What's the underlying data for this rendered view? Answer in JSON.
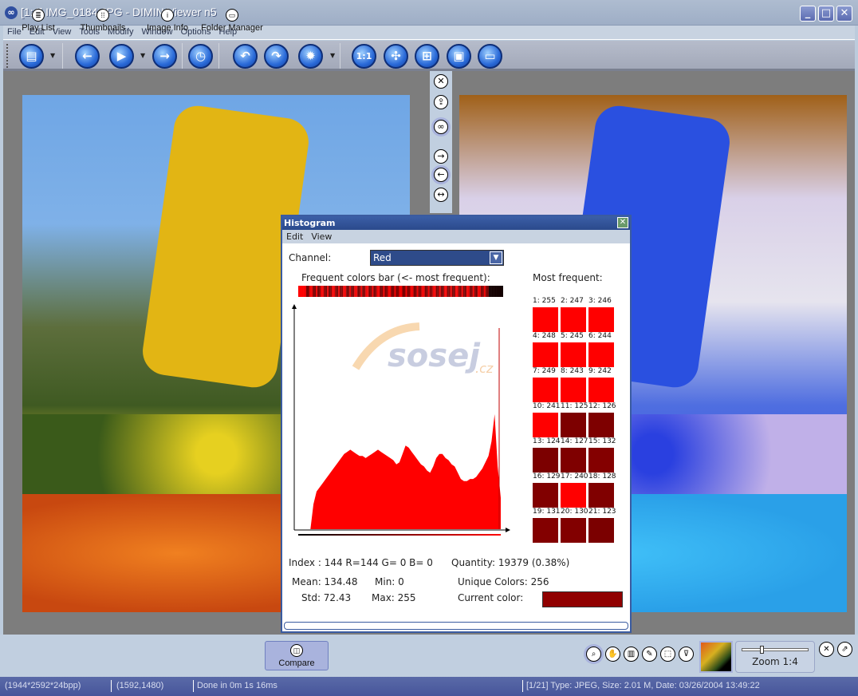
{
  "window": {
    "title": "[1:4] IMG_0184.JPG - DIMIN Viewer n5",
    "app_icon": "dimin-logo-icon",
    "controls": [
      "minimize",
      "maximize",
      "close"
    ]
  },
  "menu": [
    "File",
    "Edit",
    "View",
    "Tools",
    "Modify",
    "Window",
    "Options",
    "Help"
  ],
  "toolbar": {
    "buttons": [
      {
        "name": "open-folder",
        "glyph": "▤",
        "dropdown": true
      },
      {
        "name": "previous",
        "glyph": "←"
      },
      {
        "name": "play",
        "glyph": "▶",
        "dropdown": true
      },
      {
        "name": "next",
        "glyph": "→"
      },
      {
        "name": "slideshow-timer",
        "glyph": "◷"
      },
      {
        "name": "rotate-left",
        "glyph": "↶"
      },
      {
        "name": "rotate-right",
        "glyph": "↷"
      },
      {
        "name": "settings",
        "glyph": "✹",
        "dropdown": true
      },
      {
        "name": "actual-size",
        "glyph": "1:1"
      },
      {
        "name": "fit-to-window",
        "glyph": "✣"
      },
      {
        "name": "fit-to-screen",
        "glyph": "⊞"
      },
      {
        "name": "fullscreen",
        "glyph": "▣"
      },
      {
        "name": "monitor",
        "glyph": "▭"
      }
    ]
  },
  "compare_sidebar": [
    {
      "name": "close-compare",
      "glyph": "✕"
    },
    {
      "name": "export",
      "glyph": "⇪"
    },
    {
      "name": "link-views",
      "glyph": "∞",
      "active": true
    },
    {
      "name": "next-compare",
      "glyph": "→"
    },
    {
      "name": "prev-compare",
      "glyph": "←",
      "active": true
    },
    {
      "name": "swap",
      "glyph": "↔"
    }
  ],
  "histogram": {
    "title": "Histogram",
    "menu": [
      "Edit",
      "View"
    ],
    "channel_label": "Channel:",
    "channel_value": "Red",
    "freq_bar_label": "Frequent colors bar (<- most frequent):",
    "most_frequent_label": "Most frequent:",
    "most_frequent": [
      {
        "rank": 1,
        "value": 255
      },
      {
        "rank": 2,
        "value": 247
      },
      {
        "rank": 3,
        "value": 246
      },
      {
        "rank": 4,
        "value": 248
      },
      {
        "rank": 5,
        "value": 245
      },
      {
        "rank": 6,
        "value": 244
      },
      {
        "rank": 7,
        "value": 249
      },
      {
        "rank": 8,
        "value": 243
      },
      {
        "rank": 9,
        "value": 242
      },
      {
        "rank": 10,
        "value": 241
      },
      {
        "rank": 11,
        "value": 125
      },
      {
        "rank": 12,
        "value": 126
      },
      {
        "rank": 13,
        "value": 124
      },
      {
        "rank": 14,
        "value": 127
      },
      {
        "rank": 15,
        "value": 132
      },
      {
        "rank": 16,
        "value": 129
      },
      {
        "rank": 17,
        "value": 240
      },
      {
        "rank": 18,
        "value": 128
      },
      {
        "rank": 19,
        "value": 131
      },
      {
        "rank": 20,
        "value": 130
      },
      {
        "rank": 21,
        "value": 123
      }
    ],
    "index_line": "Index :  144   R=144  G=   0  B=   0",
    "quantity": "Quantity: 19379 (0.38%)",
    "mean": "Mean: 134.48",
    "std": "Std: 72.43",
    "min": "Min: 0",
    "max": "Max: 255",
    "unique_colors": "Unique Colors: 256",
    "current_color_label": "Current color:",
    "current_color": "#900000",
    "watermark": "sosej.cz",
    "profile": [
      0,
      0,
      0,
      0,
      0,
      0.0,
      0.12,
      0.18,
      0.2,
      0.22,
      0.24,
      0.26,
      0.28,
      0.3,
      0.32,
      0.34,
      0.36,
      0.37,
      0.38,
      0.37,
      0.36,
      0.35,
      0.35,
      0.34,
      0.35,
      0.36,
      0.37,
      0.38,
      0.37,
      0.36,
      0.35,
      0.34,
      0.33,
      0.31,
      0.32,
      0.36,
      0.4,
      0.39,
      0.37,
      0.35,
      0.33,
      0.31,
      0.3,
      0.28,
      0.27,
      0.3,
      0.34,
      0.36,
      0.36,
      0.34,
      0.33,
      0.31,
      0.3,
      0.27,
      0.24,
      0.23,
      0.23,
      0.24,
      0.24,
      0.25,
      0.27,
      0.29,
      0.32,
      0.35,
      0.42,
      0.55,
      0.3,
      0.15
    ]
  },
  "bottom_tabs": [
    {
      "label": "Play List",
      "glyph": "≣"
    },
    {
      "label": "Thumbnails",
      "glyph": "⁞⁞"
    },
    {
      "label": "Image Info",
      "glyph": "i"
    },
    {
      "label": "Folder Manager",
      "glyph": "▭"
    },
    {
      "label": "Compare",
      "glyph": "◫",
      "active": true
    }
  ],
  "tools": [
    {
      "name": "zoom-tool",
      "glyph": "⌕",
      "active": true
    },
    {
      "name": "pan-tool",
      "glyph": "✋"
    },
    {
      "name": "histogram-tool",
      "glyph": "▥"
    },
    {
      "name": "color-picker-tool",
      "glyph": "✎"
    },
    {
      "name": "select-tool",
      "glyph": "⬚"
    },
    {
      "name": "lasso-tool",
      "glyph": "⊽"
    }
  ],
  "zoom": {
    "label": "Zoom 1:4",
    "slider": 0.3
  },
  "status": {
    "dimensions": "(1944*2592*24bpp)",
    "cursor": "(1592,1480)",
    "timing": "Done in 0m 1s 16ms",
    "file_info": "[1/21] Type: JPEG, Size: 2.01 M, Date: 03/26/2004 13:49:22"
  }
}
